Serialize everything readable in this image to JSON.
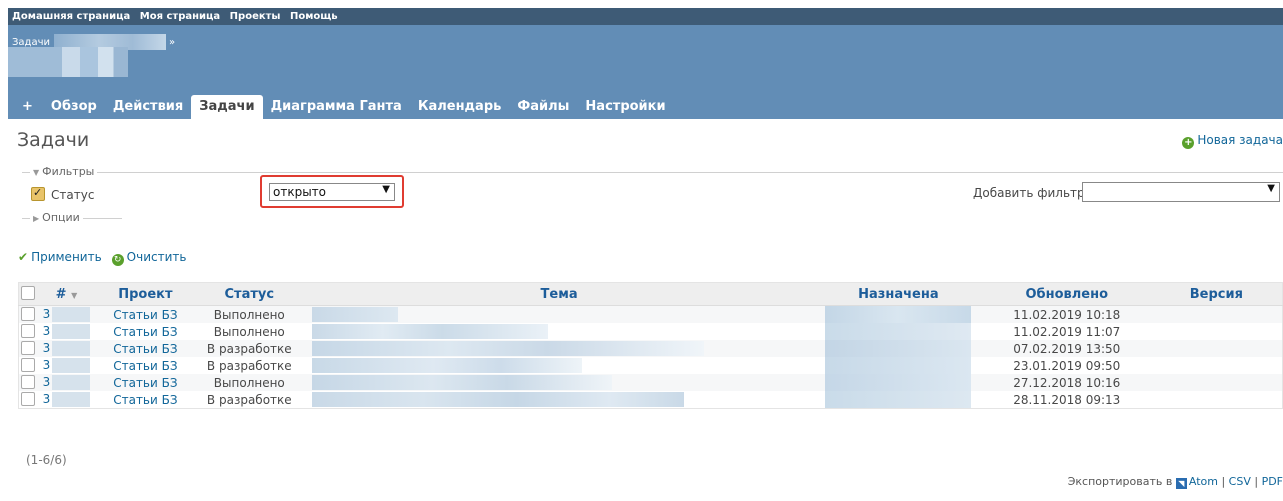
{
  "top_menu": [
    "Домашняя страница",
    "Моя страница",
    "Проекты",
    "Помощь"
  ],
  "breadcrumb": {
    "root": "Задачи",
    "separator": "»"
  },
  "tabs": [
    "+",
    "Обзор",
    "Действия",
    "Задачи",
    "Диаграмма Ганта",
    "Календарь",
    "Файлы",
    "Настройки"
  ],
  "selected_tab": "Задачи",
  "page_title": "Задачи",
  "new_issue_label": "Новая задача",
  "filters": {
    "legend": "Фильтры",
    "status_label": "Статус",
    "status_checked": true,
    "status_value": "открыто",
    "add_filter_label": "Добавить фильтр",
    "add_filter_value": ""
  },
  "options_legend": "Опции",
  "actions": {
    "apply": "Применить",
    "clear": "Очистить"
  },
  "table": {
    "columns": [
      "#",
      "Проект",
      "Статус",
      "Тема",
      "Назначена",
      "Обновлено",
      "Версия"
    ],
    "rows": [
      {
        "id": "3",
        "project": "Статьи БЗ",
        "status": "Выполнено",
        "updated": "11.02.2019 10:18"
      },
      {
        "id": "3",
        "project": "Статьи БЗ",
        "status": "Выполнено",
        "updated": "11.02.2019 11:07"
      },
      {
        "id": "3",
        "project": "Статьи БЗ",
        "status": "В разработке",
        "updated": "07.02.2019 13:50"
      },
      {
        "id": "3",
        "project": "Статьи БЗ",
        "status": "В разработке",
        "updated": "23.01.2019 09:50"
      },
      {
        "id": "3",
        "project": "Статьи БЗ",
        "status": "Выполнено",
        "updated": "27.12.2018 10:16"
      },
      {
        "id": "3",
        "project": "Статьи БЗ",
        "status": "В разработке",
        "updated": "28.11.2018 09:13"
      }
    ]
  },
  "count_text": "(1-6/6)",
  "export": {
    "prefix": "Экспортировать в",
    "formats": [
      "Atom",
      "CSV",
      "PDF"
    ]
  },
  "colors": {
    "top_menu_bg": "#3e5b76",
    "header_bg": "#628db6",
    "link": "#116699",
    "highlight_border": "#e03c31"
  }
}
